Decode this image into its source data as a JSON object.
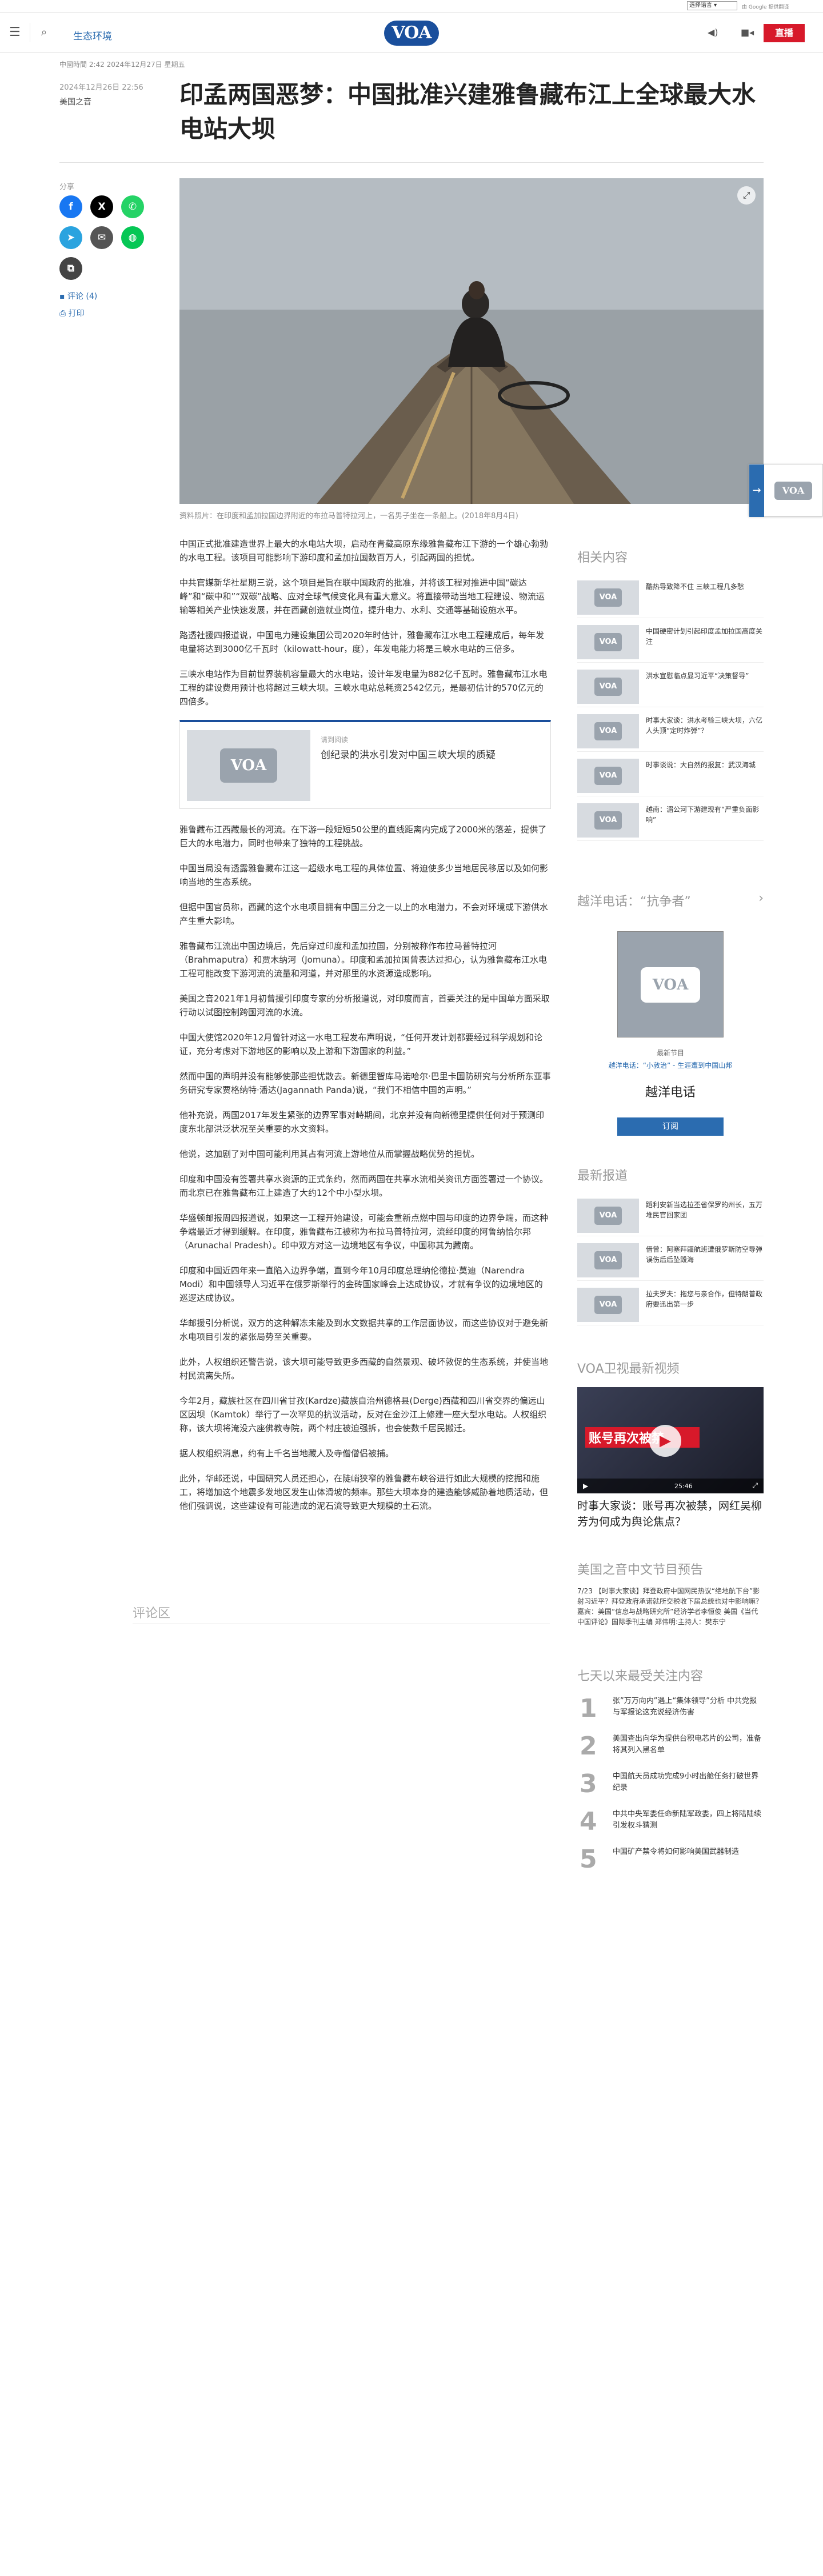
{
  "topbar": {
    "language_select": "选择语言",
    "powered_by": "由 Google 提供翻译"
  },
  "header": {
    "section": "生态环境",
    "logo": "VOA",
    "live_label": "直播"
  },
  "article": {
    "dateline": "中國時間 2:42 2024年12月27日 星期五",
    "meta_date": "2024年12月26日 22:56",
    "meta_category": "美国之音",
    "title": "印孟两国恶梦：中国批准兴建雅鲁藏布江上全球最大水电站大坝",
    "caption": "资料照片：在印度和孟加拉国边界附近的布拉马普特拉河上，一名男子坐在一条船上。(2018年8月4日)",
    "paragraphs": [
      "中国正式批准建造世界上最大的水电站大坝，启动在青藏高原东缘雅鲁藏布江下游的一个雄心勃勃的水电工程。该项目可能影响下游印度和孟加拉国数百万人，引起两国的担忧。",
      "中共官媒新华社星期三说，这个项目是旨在联中国政府的批准，并将该工程对推进中国“碳达峰”和“碳中和”“双碳”战略、应对全球气候变化具有重大意义。将直接带动当地工程建设、物流运输等相关产业快速发展，并在西藏创造就业岗位，提升电力、水利、交通等基础设施水平。",
      "路透社援四报道说，中国电力建设集团公司2020年时估计，雅鲁藏布江水电工程建成后，每年发电量将达到3000亿千瓦时（kilowatt-hour，度），年发电能力将是三峡水电站的三倍多。",
      "三峡水电站作为目前世界装机容量最大的水电站，设计年发电量为882亿千瓦时。雅鲁藏布江水电工程的建设费用预计也将超过三峡大坝。三峡水电站总耗资2542亿元，是最初估计的570亿元的四倍多。",
      "雅鲁藏布江西藏最长的河流。在下游一段短短50公里的直线距离内完成了2000米的落差，提供了巨大的水电潜力，同时也带来了独特的工程挑战。",
      "中国当局没有透露雅鲁藏布江这一超级水电工程的具体位置、将迫使多少当地居民移居以及如何影响当地的生态系统。",
      "但据中国官员称，西藏的这个水电项目拥有中国三分之一以上的水电潜力，不会对环境或下游供水产生重大影响。",
      "雅鲁藏布江流出中国边境后，先后穿过印度和孟加拉国，分别被称作布拉马普特拉河（Brahmaputra）和贾木纳河（Jomuna）。印度和孟加拉国曾表达过担心，认为雅鲁藏布江水电工程可能改变下游河流的流量和河道，并对那里的水资源造成影响。",
      "美国之音2021年1月初曾援引印度专家的分析报道说，对印度而言，首要关注的是中国单方面采取行动以试图控制跨国河流的水流。",
      "中国大使馆2020年12月曾针对这一水电工程发布声明说，“任何开发计划都要经过科学规划和论证，充分考虑对下游地区的影响以及上游和下游国家的利益。”",
      "然而中国的声明并没有能够使那些担忧散去。新德里智库马诺哈尔·巴里卡国防研究与分析所东亚事务研究专家贾格纳特·潘达(Jagannath Panda)说，“我们不相信中国的声明。”",
      "他补充说，两国2017年发生紧张的边界军事对峙期间，北京并没有向新德里提供任何对于预测印度东北部洪泛状况至关重要的水文资料。",
      "他说，这加剧了对中国可能利用其占有河流上游地位从而掌握战略优势的担忧。",
      "印度和中国没有签署共享水资源的正式条约，然而两国在共享水流相关资讯方面签署过一个协议。而北京已在雅鲁藏布江上建造了大约12个中小型水坝。",
      "华盛顿邮报周四报道说，如果这一工程开始建设，可能会重新点燃中国与印度的边界争端，而这种争端最近才得到缓解。在印度，雅鲁藏布江被称为布拉马普特拉河，流经印度的阿鲁纳恰尔邦（Arunachal Pradesh）。印中双方对这一边境地区有争议，中国称其为藏南。",
      "印度和中国近四年来一直陷入边界争端，直到今年10月印度总理纳伦德拉·莫迪（Narendra Modi）和中国领导人习近平在俄罗斯举行的金砖国家峰会上达成协议，才就有争议的边境地区的巡逻达成协议。",
      "华邮援引分析说，双方的这种解冻未能及到水文数据共享的工作层面协议，而这些协议对于避免新水电项目引发的紧张局势至关重要。",
      "此外，人权组织还警告说，该大坝可能导致更多西藏的自然景观、破坏敦促的生态系统，并使当地村民流离失所。",
      "今年2月，藏族社区在四川省甘孜(Kardze)藏族自治州德格县(Derge)西藏和四川省交界的偏远山区因坝（Kamtok）举行了一次罕见的抗议活动，反对在金沙江上修建一座大型水电站。人权组织称，该大坝将淹没六座佛教寺院，两个村庄被迫强拆，也会使数千居民搬迁。",
      "据人权组织消息，约有上千名当地藏人及寺僧僧侣被捕。",
      "此外，华邮还说，中国研究人员还担心，在陡峭狭窄的雅鲁藏布峡谷进行如此大规模的挖掘和施工，将增加这个地震多发地区发生山体滑坡的频率。那些大坝本身的建造能够威胁着地质活动，但他们强调说，这些建设有可能造成的泥石流导致更大规模的土石流。"
    ],
    "related": {
      "tag": "请到阅读",
      "title": "创纪录的洪水引发对中国三峡大坝的质疑"
    },
    "comments_label": "评论区"
  },
  "share": {
    "label": "分享",
    "comments_link": "评论 (4)",
    "print_link": "打印"
  },
  "rail": {
    "related_title": "相关内容",
    "related_items": [
      "酷热导致降不住 三峡工程几多愁",
      "中国硬密计划引起印度孟加拉国高度关注",
      "洪水宣慰临点显习近平“决策督导”",
      "时事大家谈：洪水考验三峡大坝，六亿人头顶“定时炸弹”？",
      "时事谈说：大自然的报复：武汉海城",
      "越南：湄公河下游建现有“严重负面影响”"
    ],
    "radio_title": "越洋电话：“抗争者”",
    "radio_caption": "最新节目",
    "radio_link": "越洋电话：“小敦治” - 生涯遭到中国山邦",
    "radio_name": "越洋电话",
    "radio_subscribe": "订阅",
    "latest_title": "最新报道",
    "latest_items": [
      "蹈利安新当选拉丕省保罗的州长，五万堆民官回家团",
      "借曾：阿塞拜疆航班遭俄罗斯防空导弹误伤后后坠毁海",
      "拉夫罗夫：拖您与亲合作，但特朗普政府要迅出第一步"
    ],
    "video_title": "VOA卫视最新视频",
    "video_overlay": "账号再次被禁",
    "video_time": "25:46",
    "video_caption": "时事大家谈：账号再次被禁，网红吴柳芳为何成为舆论焦点？",
    "program_title": "美国之音中文节目预告",
    "program_text": "7/23 【时事大家谈】拜登政府中国网民热议“绝地航下台”影射习近平？拜登政府承诺就所交税收下届总统也对中影响嘛？嘉宾：美国“信息与战略研究所”经济学者李恒俊 美国《当代中国评论》国际季刊主编 郑伟明:主持人：樊东宁",
    "top_title": "七天以来最受关注内容",
    "top_items": [
      "张”万万向内”遇上“集体领导”分析 中共党报与军报论这充说经济伤害",
      "美国查出向华为提供台积电芯片的公司，准备将其列入黑名单",
      "中国航天员成功完成9小时出舱任务打破世界纪录",
      "中共中央军委任命新陆军政委，四上将陆陆续引发权斗猜测",
      "中国矿产禁令将如何影响美国武器制造"
    ]
  },
  "colors": {
    "brand": "#1a4f9c",
    "live": "#d7192a",
    "link": "#2b6cb0"
  }
}
